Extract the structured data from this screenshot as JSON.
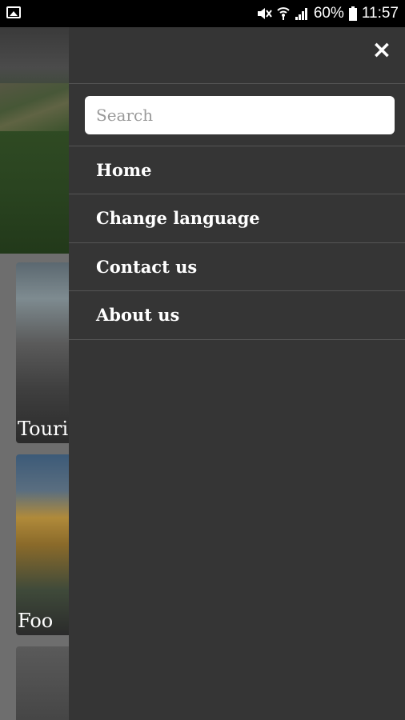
{
  "status_bar": {
    "left_icon": "image-icon",
    "right_icons": [
      "mute-icon",
      "wifi-icon",
      "signal-icon"
    ],
    "battery_text": "60%",
    "battery_icon": "battery-icon",
    "time": "11:57"
  },
  "background": {
    "cards": [
      {
        "caption": "Touri"
      },
      {
        "caption": "Foo"
      },
      {
        "caption": ""
      }
    ]
  },
  "drawer": {
    "close_icon": "close-icon",
    "search": {
      "placeholder": "Search",
      "value": ""
    },
    "items": [
      {
        "label": "Home"
      },
      {
        "label": "Change language"
      },
      {
        "label": "Contact us"
      },
      {
        "label": "About us"
      }
    ]
  },
  "colors": {
    "drawer_bg": "#353535",
    "divider": "#555555",
    "text": "#ffffff"
  }
}
